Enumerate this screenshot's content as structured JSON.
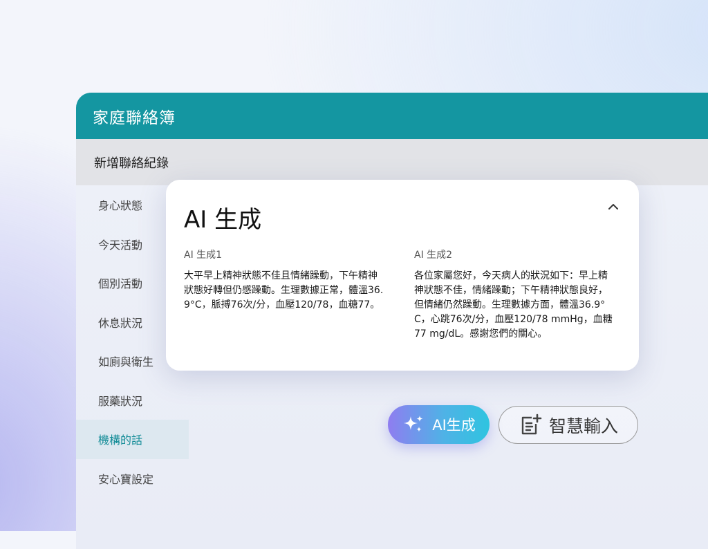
{
  "app": {
    "title": "家庭聯絡簿",
    "subheader": "新增聯絡紀錄"
  },
  "sidebar": {
    "items": [
      {
        "label": "身心狀態"
      },
      {
        "label": "今天活動"
      },
      {
        "label": "個別活動"
      },
      {
        "label": "休息狀況"
      },
      {
        "label": "如廁與衛生"
      },
      {
        "label": "服藥狀況"
      },
      {
        "label": "機構的話",
        "active": true
      },
      {
        "label": "安心寶設定"
      }
    ]
  },
  "ai_panel": {
    "title": "AI 生成",
    "options": [
      {
        "title": "AI 生成1",
        "text": "大平早上精神狀態不佳且情緒躁動，下午精神狀態好轉但仍感躁動。生理數據正常，體溫36.9°C，脈搏76次/分，血壓120/78，血糖77。"
      },
      {
        "title": "AI 生成2",
        "text": "各位家屬您好，今天病人的狀況如下：早上精神狀態不佳，情緒躁動；下午精神狀態良好，但情緒仍然躁動。生理數據方面，體溫36.9°C，心跳76次/分，血壓120/78 mmHg，血糖77 mg/dL。感謝您們的關心。"
      }
    ]
  },
  "actions": {
    "ai_button_label": "AI生成",
    "smart_input_label": "智慧輸入"
  },
  "icons": {
    "collapse": "chevron-up-icon",
    "ai": "sparkle-icon",
    "smart_input": "note-add-icon"
  },
  "colors": {
    "header": "#1496a1",
    "active_item": "#138c97",
    "ai_gradient_start": "#8f7df0",
    "ai_gradient_end": "#2fc4e0"
  }
}
